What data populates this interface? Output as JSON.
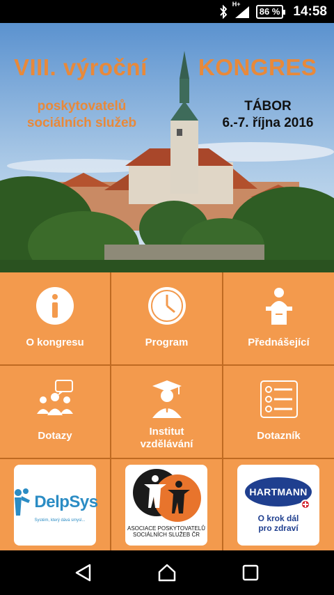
{
  "status_bar": {
    "signal_text": "H+",
    "battery": "86 %",
    "time": "14:58"
  },
  "banner": {
    "title_left": "VIII. výroční",
    "title_right": "KONGRES",
    "subtitle_line1": "poskytovatelů",
    "subtitle_line2": "sociálních služeb",
    "city": "TÁBOR",
    "dates": "6.-7. října 2016"
  },
  "tiles": {
    "about": "O kongresu",
    "program": "Program",
    "speakers": "Přednášející",
    "questions": "Dotazy",
    "institute_line1": "Institut",
    "institute_line2": "vzdělávání",
    "questionnaire": "Dotazník"
  },
  "sponsors": {
    "delpsys_name": "DelpSys",
    "delpsys_tagline": "Systém, který dává smysl...",
    "asociace_line1": "ASOCIACE POSKYTOVATELŮ",
    "asociace_line2": "SOCIÁLNÍCH SLUŽEB ČR",
    "hartmann_name": "HARTMANN",
    "hartmann_line1": "O krok dál",
    "hartmann_line2": "pro zdraví"
  },
  "colors": {
    "tile_orange": "#f39a4d",
    "title_orange": "#e8893a"
  }
}
